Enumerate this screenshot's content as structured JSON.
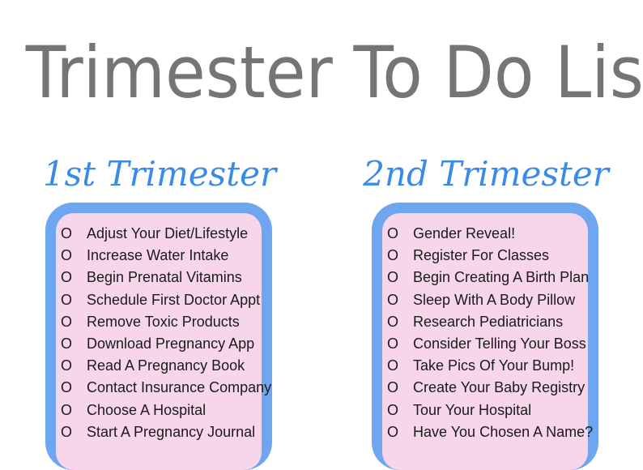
{
  "title": "Trimester To Do Lists",
  "bullet_glyph": "O",
  "colors": {
    "heading": "#3a8ae8",
    "panel_border": "#6fa6f0",
    "panel_fill": "#f7d6ec",
    "title": "#757575"
  },
  "columns": [
    {
      "heading": "1st Trimester",
      "items": [
        "Adjust Your Diet/Lifestyle",
        "Increase Water Intake",
        "Begin Prenatal Vitamins",
        "Schedule First Doctor Appt",
        "Remove Toxic Products",
        "Download Pregnancy App",
        "Read A Pregnancy Book",
        "Contact Insurance Company",
        "Choose A Hospital",
        "Start A Pregnancy Journal"
      ]
    },
    {
      "heading": "2nd Trimester",
      "items": [
        "Gender Reveal!",
        "Register For Classes",
        "Begin Creating A Birth Plan",
        "Sleep With A Body Pillow",
        "Research Pediatricians",
        "Consider Telling Your Boss",
        "Take Pics Of Your Bump!",
        "Create Your Baby Registry",
        "Tour Your Hospital",
        "Have You Chosen A Name?"
      ]
    }
  ]
}
